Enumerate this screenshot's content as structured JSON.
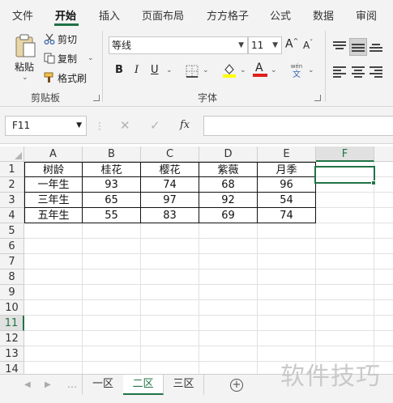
{
  "ribbon_tabs": [
    "文件",
    "开始",
    "插入",
    "页面布局",
    "方方格子",
    "公式",
    "数据",
    "审阅"
  ],
  "active_tab": "开始",
  "clipboard": {
    "paste_label": "粘贴",
    "cut_label": "剪切",
    "copy_label": "复制",
    "format_painter_label": "格式刷",
    "group_label": "剪贴板"
  },
  "font": {
    "name": "等线",
    "size": "11",
    "grow_label": "A",
    "shrink_label": "A",
    "bold": "B",
    "italic": "I",
    "underline": "U",
    "font_color_label": "A",
    "phonetic_top": "wén",
    "phonetic_bottom": "文",
    "group_label": "字体",
    "font_color": "#e0201b",
    "highlight_color": "#ffff00"
  },
  "formula_bar": {
    "name_box": "F11",
    "cancel": "✕",
    "confirm": "✓",
    "fx": "fx",
    "value": ""
  },
  "columns": [
    "A",
    "B",
    "C",
    "D",
    "E",
    "F"
  ],
  "rows": [
    "1",
    "2",
    "3",
    "4",
    "5",
    "6",
    "7",
    "8",
    "9",
    "10",
    "11",
    "12",
    "13",
    "14"
  ],
  "selected_cell": "F11",
  "table": {
    "header": [
      "树龄",
      "桂花",
      "樱花",
      "紫薇",
      "月季"
    ],
    "rows": [
      [
        "一年生",
        "93",
        "74",
        "68",
        "96"
      ],
      [
        "三年生",
        "65",
        "97",
        "92",
        "54"
      ],
      [
        "五年生",
        "55",
        "83",
        "69",
        "74"
      ]
    ]
  },
  "sheets": [
    "一区",
    "二区",
    "三区"
  ],
  "active_sheet": "二区",
  "add_sheet_label": "+",
  "watermark": "软件技巧",
  "accent_color": "#217346"
}
